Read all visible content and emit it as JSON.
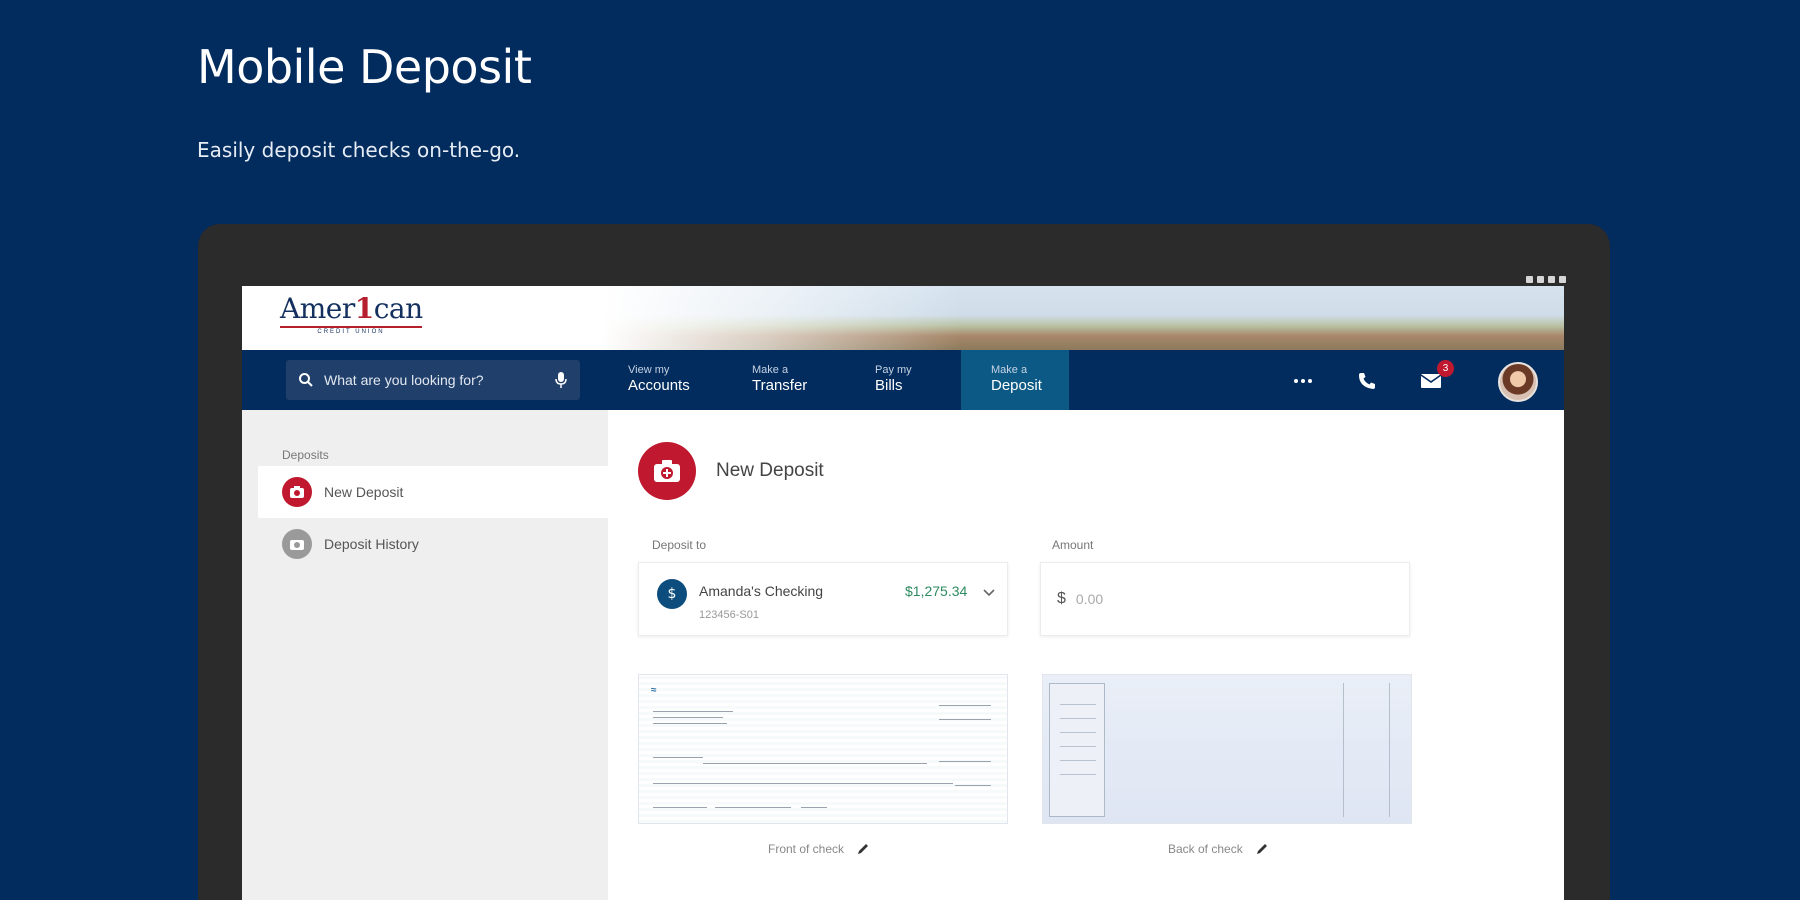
{
  "promo": {
    "title": "Mobile Deposit",
    "subtitle": "Easily deposit checks on-the-go."
  },
  "app": {
    "brand": {
      "logo_text_pre": "Amer",
      "logo_text_one": "1",
      "logo_text_post": "can",
      "logo_tagline": "CREDIT UNION"
    },
    "search": {
      "placeholder": "What are you looking for?"
    },
    "nav": [
      {
        "small": "View my",
        "big": "Accounts",
        "active": false
      },
      {
        "small": "Make a",
        "big": "Transfer",
        "active": false
      },
      {
        "small": "Pay my",
        "big": "Bills",
        "active": false
      },
      {
        "small": "Make a",
        "big": "Deposit",
        "active": true
      }
    ],
    "toolbar": {
      "more_icon": "more-horizontal-icon",
      "phone_icon": "phone-icon",
      "mail_icon": "mail-icon",
      "mail_badge": "3"
    },
    "sidebar": {
      "section_label": "Deposits",
      "items": [
        {
          "label": "New Deposit",
          "icon": "camera-icon",
          "active": true
        },
        {
          "label": "Deposit History",
          "icon": "history-icon",
          "active": false
        }
      ]
    },
    "main": {
      "title": "New Deposit",
      "deposit_to_label": "Deposit to",
      "account": {
        "name": "Amanda's Checking",
        "number": "123456-S01",
        "balance": "$1,275.34"
      },
      "amount_label": "Amount",
      "amount_currency": "$",
      "amount_placeholder": "0.00",
      "front_caption": "Front of check",
      "back_caption": "Back of check"
    }
  },
  "colors": {
    "page_background": "#022b5e",
    "nav_background": "#022b5e",
    "nav_active": "#0c5985",
    "accent_red": "#c0192f",
    "balance_green": "#2e8b5f"
  }
}
